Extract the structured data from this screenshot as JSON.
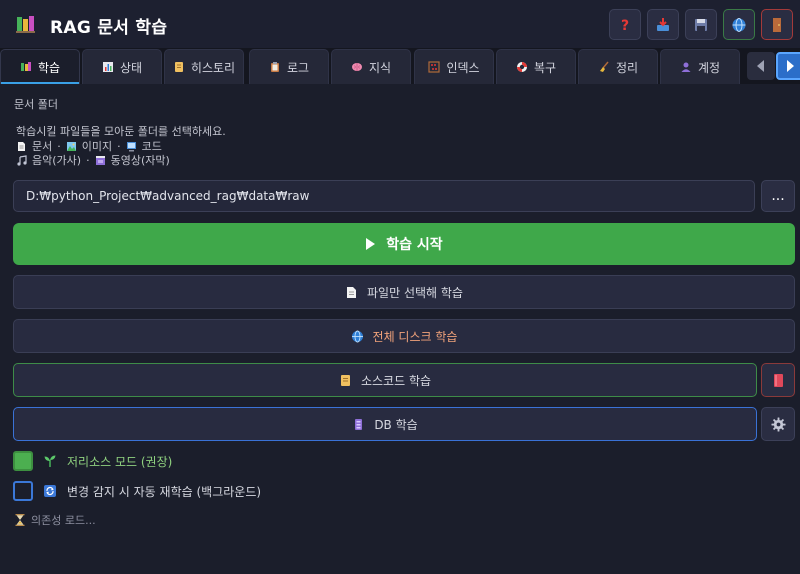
{
  "app": {
    "title": "RAG 문서 학습",
    "logo_icon": "books-icon"
  },
  "toolbar": {
    "buttons": [
      {
        "name": "help-button",
        "icon": "question-icon"
      },
      {
        "name": "inbox-button",
        "icon": "inbox-tray-icon"
      },
      {
        "name": "save-button",
        "icon": "floppy-disk-icon"
      },
      {
        "name": "language-button",
        "icon": "globe-icon"
      },
      {
        "name": "exit-button",
        "icon": "door-icon"
      }
    ]
  },
  "tabs": [
    {
      "label": "학습",
      "icon": "books-icon",
      "active": true
    },
    {
      "label": "상태",
      "icon": "bar-chart-icon",
      "active": false
    },
    {
      "label": "히스토리",
      "icon": "scroll-icon",
      "active": false
    },
    {
      "label": "로그",
      "icon": "clipboard-icon",
      "active": false
    },
    {
      "label": "지식",
      "icon": "brain-icon",
      "active": false
    },
    {
      "label": "인덱스",
      "icon": "abacus-icon",
      "active": false
    },
    {
      "label": "복구",
      "icon": "lifebuoy-icon",
      "active": false
    },
    {
      "label": "정리",
      "icon": "broom-icon",
      "active": false
    },
    {
      "label": "계정",
      "icon": "user-icon",
      "active": false
    }
  ],
  "main": {
    "section_label": "문서 폴더",
    "description": "학습시킬 파일들을 모아둔 폴더를 선택하세요.",
    "file_types": {
      "document": "문서",
      "image": "이미지",
      "code": "코드",
      "music": "음악(가사)",
      "video": "동영상(자막)",
      "separator": "·"
    },
    "folder_path": "D:₩python_Project₩advanced_rag₩data₩raw",
    "browse_label": "...",
    "start_button": "학습 시작",
    "select_files_button": "파일만 선택해 학습",
    "full_disk_button": "전체 디스크 학습",
    "source_code_button": "소스코드 학습",
    "db_button": "DB 학습",
    "low_resource_mode": {
      "label": "저리소스 모드 (권장)",
      "checked": true
    },
    "auto_relearn": {
      "label": "변경 감지 시 자동 재학습 (백그라운드)",
      "checked": false
    },
    "loading_text": "의존성 로드..."
  },
  "colors": {
    "background": "#1b1e2b",
    "accent_green": "#3fa84a",
    "accent_blue": "#2b6ec9",
    "low_resource_text": "#8fd17f",
    "full_disk_text": "#f0a27a"
  }
}
